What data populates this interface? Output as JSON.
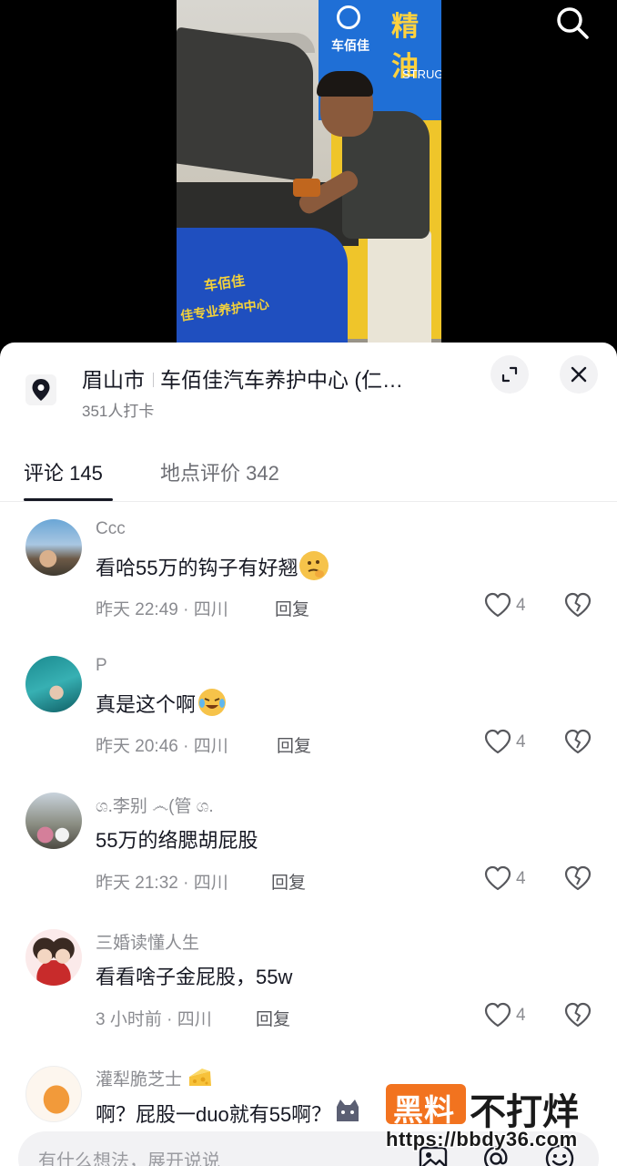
{
  "poi": {
    "city": "眉山市",
    "name": "车佰佳汽车养护中心 (仁…",
    "checkins": "351人打卡"
  },
  "tabs": {
    "comments": "评论 145",
    "reviews": "地点评价 342"
  },
  "comments": [
    {
      "user": "Ccc",
      "text": "看哈55万的钩子有好翘",
      "emoji": "thinking-face",
      "meta": "昨天 22:49 · 四川",
      "reply": "回复",
      "likes": "4"
    },
    {
      "user": "P",
      "text": "真是这个啊",
      "emoji": "crying-laughing-face",
      "meta": "昨天 20:46 · 四川",
      "reply": "回复",
      "likes": "4"
    },
    {
      "user": "ශ.李别 ෴(管 ශ.",
      "text": "55万的络腮胡屁股",
      "meta": "昨天 21:32 · 四川",
      "reply": "回复",
      "likes": "4"
    },
    {
      "user": "三婚读懂人生",
      "text": "看看啥子金屁股，55w",
      "meta": "3 小时前 · 四川",
      "reply": "回复",
      "likes": "4"
    },
    {
      "user": "灌犁脆芝士",
      "user_emoji": "cheese",
      "text": "啊？屁股一duo就有55啊？",
      "emoji": "cat-face"
    }
  ],
  "input": {
    "placeholder": "有什么想法，展开说说"
  },
  "watermark": {
    "box": "黑料",
    "text": "不打烊",
    "url": "https://bbdy36.com"
  },
  "video_sign": {
    "brand": "车佰佳",
    "slogan": "精油",
    "english": "STRUG",
    "cover_brand": "车佰佳",
    "cover_slogan": "佳专业养护中心"
  },
  "colors": {
    "accent": "#161823",
    "muted": "#8a8b90",
    "watermark_orange": "#f2731f",
    "sign_blue": "#1f6fd6",
    "sign_yellow": "#efc52a"
  }
}
